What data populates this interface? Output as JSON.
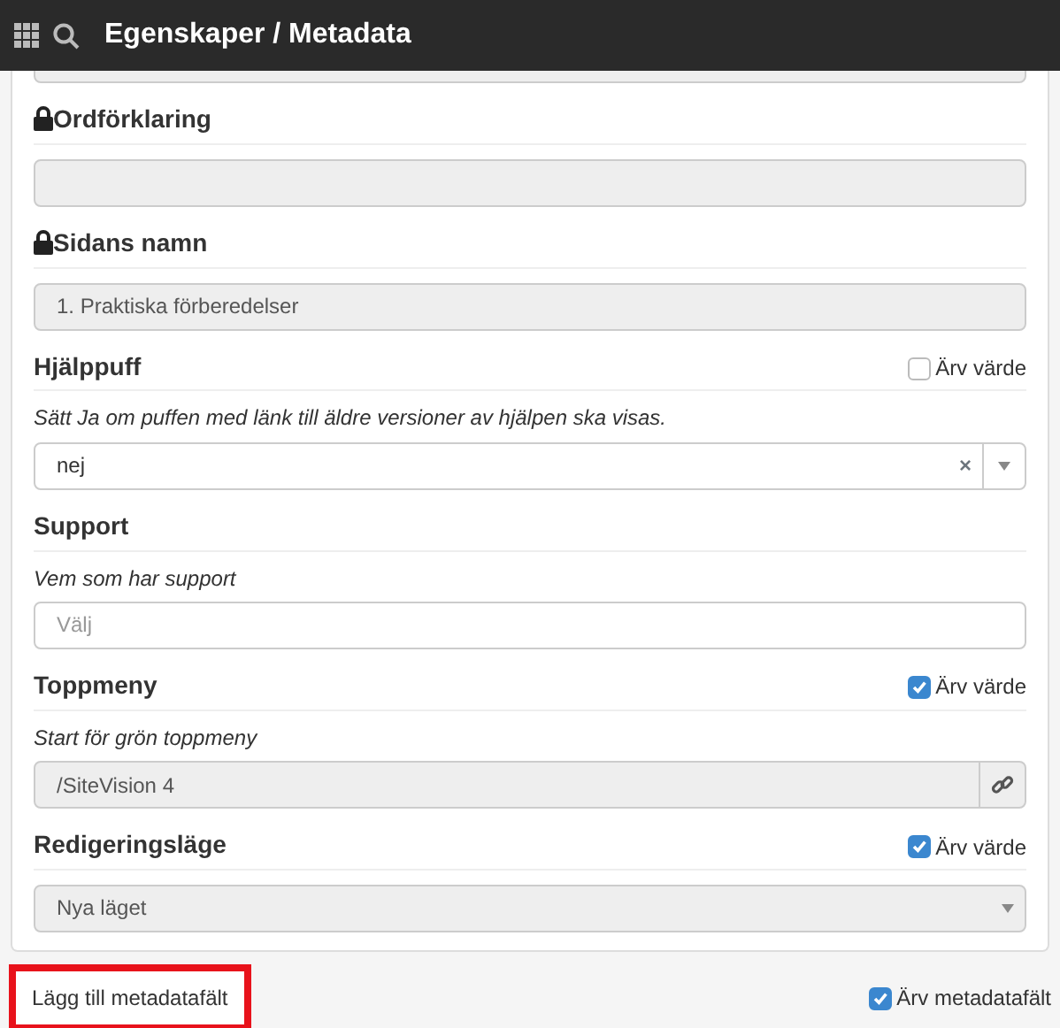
{
  "header": {
    "title": "Egenskaper / Metadata"
  },
  "fields": [
    {
      "input": {
        "kind": "readonly"
      }
    },
    {
      "label": "Ordförklaring",
      "locked": true,
      "input": {
        "kind": "readonly"
      }
    },
    {
      "label": "Sidans namn",
      "locked": true,
      "input": {
        "kind": "readonly",
        "value": "1. Praktiska förberedelser"
      }
    },
    {
      "label": "Hjälppuff",
      "locked": false,
      "inherit": {
        "label": "Ärv värde",
        "checked": false
      },
      "help": "Sätt Ja om puffen med länk till äldre versioner av hjälpen ska visas.",
      "input": {
        "kind": "select-clear",
        "value": "nej",
        "clear_symbol": "×"
      }
    },
    {
      "label": "Support",
      "locked": false,
      "help": "Vem som har support",
      "input": {
        "kind": "text",
        "placeholder": "Välj"
      }
    },
    {
      "label": "Toppmeny",
      "locked": false,
      "inherit": {
        "label": "Ärv värde",
        "checked": true
      },
      "help": "Start för grön toppmeny",
      "input": {
        "kind": "link",
        "value": "/SiteVision 4"
      }
    },
    {
      "label": "Redigeringsläge",
      "locked": false,
      "inherit": {
        "label": "Ärv värde",
        "checked": true
      },
      "input": {
        "kind": "select",
        "value": "Nya läget"
      }
    }
  ],
  "footer": {
    "add_button": {
      "label": "Lägg till metadatafält",
      "highlighted": true
    },
    "inherit": {
      "label": "Ärv metadatafält",
      "checked": true
    }
  }
}
